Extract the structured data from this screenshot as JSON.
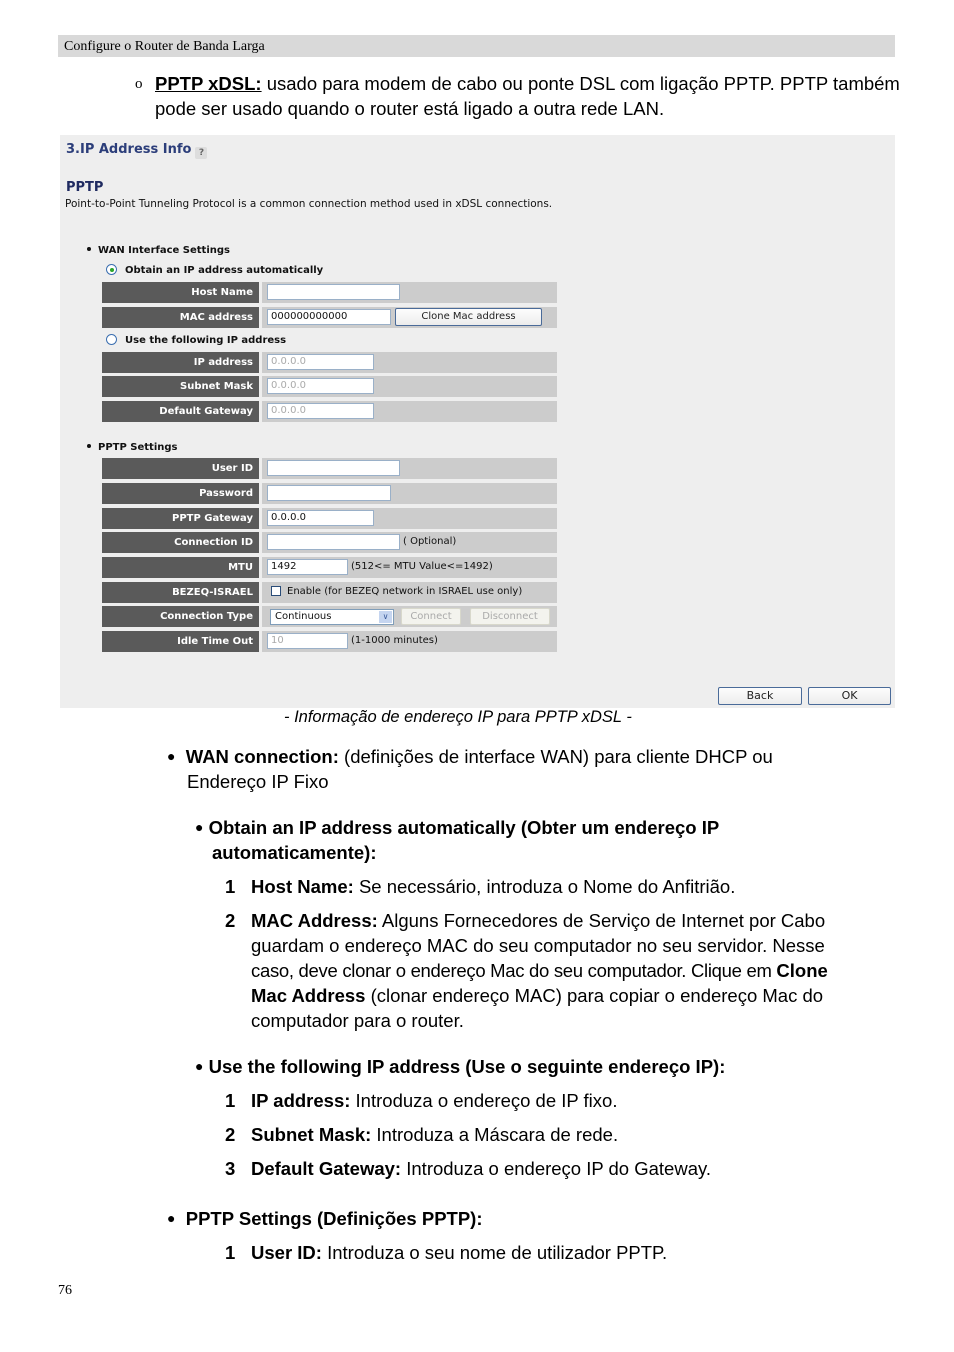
{
  "header": {
    "title": "Configure o Router de Banda Larga"
  },
  "intro": {
    "bullet": "o",
    "term": "PPTP xDSL:",
    "text": " usado para modem de cabo ou ponte DSL com ligação PPTP. PPTP também pode ser usado quando o router está ligado a outra rede LAN."
  },
  "screenshot": {
    "section_title": "3.IP Address Info",
    "help_icon": "help-icon",
    "mode_title": "PPTP",
    "mode_description": "Point-to-Point Tunneling Protocol is a common connection method used in xDSL connections.",
    "wan_section": "WAN Interface Settings",
    "radio_auto": {
      "label": "Obtain an IP address automatically",
      "checked": true
    },
    "host_name": {
      "label": "Host Name",
      "value": ""
    },
    "mac_address": {
      "label": "MAC address",
      "value": "000000000000",
      "clone_button": "Clone Mac address"
    },
    "radio_fixed": {
      "label": "Use the following IP address",
      "checked": false
    },
    "ip_address": {
      "label": "IP address",
      "value": "0.0.0.0"
    },
    "subnet_mask": {
      "label": "Subnet Mask",
      "value": "0.0.0.0"
    },
    "default_gateway": {
      "label": "Default Gateway",
      "value": "0.0.0.0"
    },
    "pptp_section": "PPTP Settings",
    "user_id": {
      "label": "User ID",
      "value": ""
    },
    "password": {
      "label": "Password",
      "value": ""
    },
    "pptp_gateway": {
      "label": "PPTP Gateway",
      "value": "0.0.0.0"
    },
    "connection_id": {
      "label": "Connection ID",
      "value": "",
      "note": "( Optional)"
    },
    "mtu": {
      "label": "MTU",
      "value": "1492",
      "note": "(512<= MTU Value<=1492)"
    },
    "bezeq": {
      "label": "BEZEQ-ISRAEL",
      "checkbox_label": "Enable (for BEZEQ network in ISRAEL use only)",
      "checked": false
    },
    "connection_type": {
      "label": "Connection Type",
      "selected": "Continuous",
      "connect_button": "Connect",
      "disconnect_button": "Disconnect"
    },
    "idle_time_out": {
      "label": "Idle Time Out",
      "value": "10",
      "note": "(1-1000 minutes)"
    },
    "back_button": "Back",
    "ok_button": "OK"
  },
  "caption": "- Informação de endereço IP para PPTP xDSL -",
  "content": {
    "wan_bullet": {
      "bullet": "●",
      "term": "WAN connection:",
      "text": " (definições de interface WAN) para cliente DHCP ou",
      "text2": "Endereço IP Fixo"
    },
    "auto_bullet": {
      "bullet": "●",
      "term": "Obtain an IP address automatically (Obter um endereço IP",
      "term2": "automaticamente):"
    },
    "auto_items": [
      {
        "num": "1",
        "term": "Host Name:",
        "text": " Se necessário, introduza o Nome do Anfitrião."
      },
      {
        "num": "2",
        "term": "MAC Address:",
        "text": " Alguns Fornecedores de Serviço de Internet por Cabo",
        "line2": "guardam o endereço MAC do seu computador no seu servidor. Nesse",
        "line3": "caso, deve clonar o endereço Mac do seu computador. Clique em ",
        "line3_bold": "Clone",
        "line4_bold": "Mac Address",
        "line4": " (clonar endereço MAC) para copiar o endereço Mac do",
        "line5": "computador para o router."
      }
    ],
    "fixed_bullet": {
      "bullet": "●",
      "term": "Use the following IP address (Use o seguinte endereço IP):"
    },
    "fixed_items": [
      {
        "num": "1",
        "term": "IP address:",
        "text": " Introduza o endereço de IP fixo."
      },
      {
        "num": "2",
        "term": "Subnet Mask:",
        "text": " Introduza a Máscara de rede."
      },
      {
        "num": "3",
        "term": "Default Gateway:",
        "text": " Introduza o endereço IP do Gateway."
      }
    ],
    "pptp_bullet": {
      "bullet": "●",
      "term": "PPTP Settings (Definições PPTP):"
    },
    "pptp_items": [
      {
        "num": "1",
        "term": "User ID:",
        "text": " Introduza o seu nome de utilizador PPTP."
      }
    ]
  },
  "page_number": "76"
}
